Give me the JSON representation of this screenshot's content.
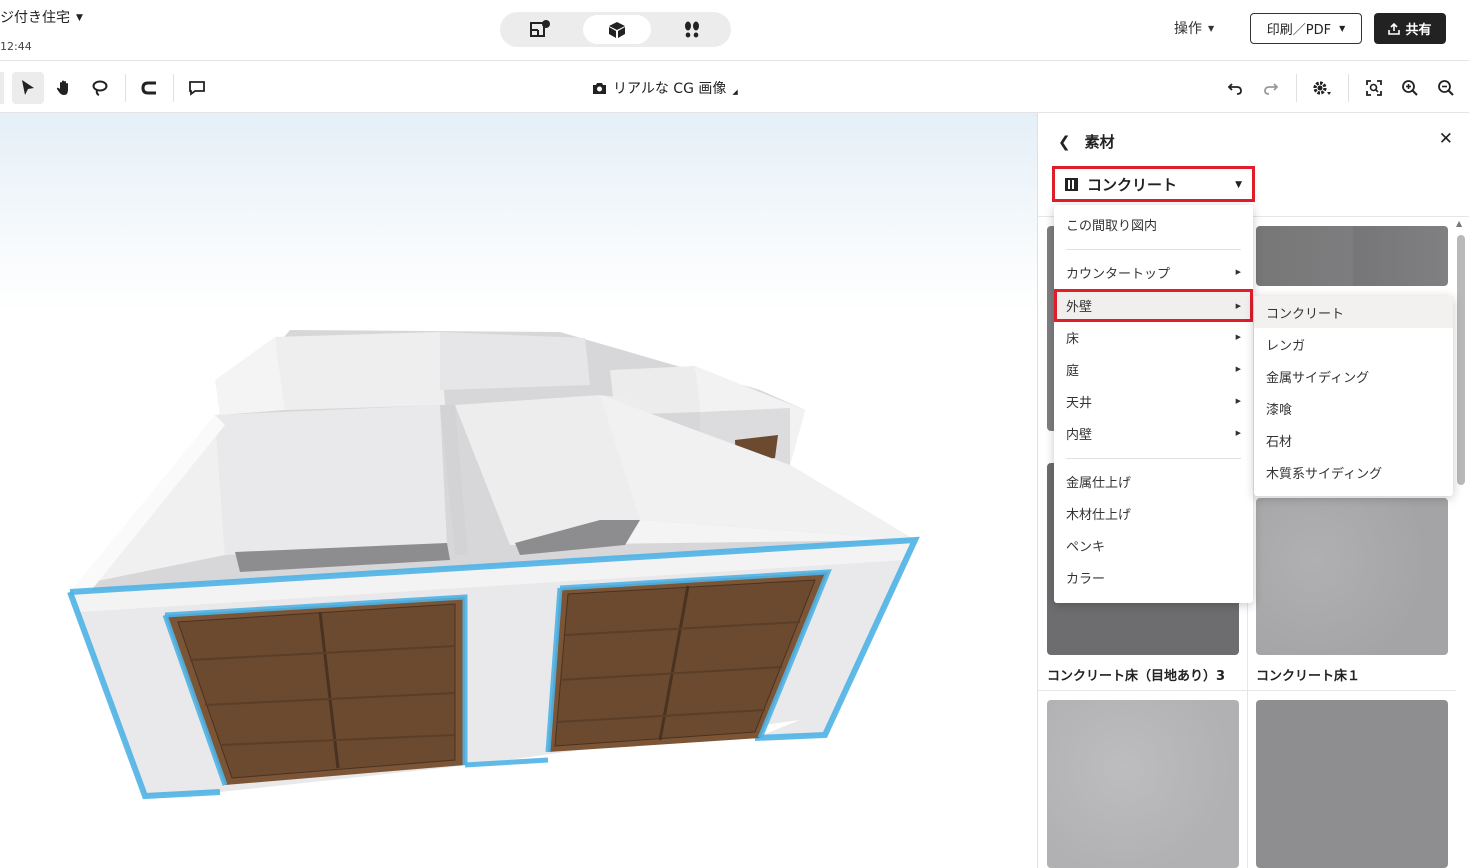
{
  "header": {
    "doc_title": "ジ付き住宅",
    "time": "12:44",
    "view_modes": [
      "2d-plan-icon",
      "3d-box-icon",
      "walkthrough-icon"
    ],
    "operations_label": "操作",
    "print_label": "印刷／PDF",
    "share_label": "共有"
  },
  "toolbar": {
    "cg_label": "リアルな CG 画像"
  },
  "panel": {
    "title": "素材",
    "selected_category": "コンクリート",
    "tiles": [
      {
        "label": "コンクリート床（目地あり）3"
      },
      {
        "label": "コンクリート床１"
      }
    ]
  },
  "menu": {
    "items": [
      {
        "label": "この間取り図内",
        "submenu": false
      },
      {
        "label": "カウンタートップ",
        "submenu": true
      },
      {
        "label": "外壁",
        "submenu": true
      },
      {
        "label": "床",
        "submenu": true
      },
      {
        "label": "庭",
        "submenu": true
      },
      {
        "label": "天井",
        "submenu": true
      },
      {
        "label": "内壁",
        "submenu": true
      },
      {
        "label": "金属仕上げ",
        "submenu": false
      },
      {
        "label": "木材仕上げ",
        "submenu": false
      },
      {
        "label": "ペンキ",
        "submenu": false
      },
      {
        "label": "カラー",
        "submenu": false
      }
    ],
    "highlighted": "外壁"
  },
  "submenu": {
    "items": [
      "コンクリート",
      "レンガ",
      "金属サイディング",
      "漆喰",
      "石材",
      "木質系サイディング"
    ]
  },
  "colors": {
    "highlight_border": "#e01e2a",
    "selection_glow": "#4fb3e6",
    "garage_door": "#6b4a30"
  }
}
